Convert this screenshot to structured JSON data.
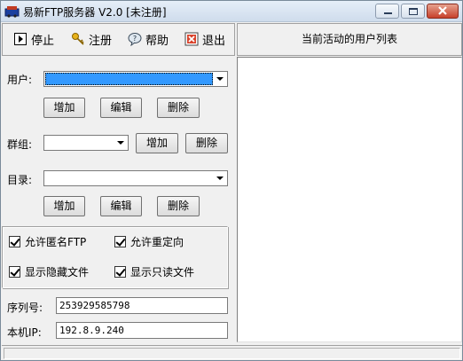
{
  "window": {
    "title": "易新FTP服务器 V2.0 [未注册]"
  },
  "toolbar": {
    "stop_label": "停止",
    "register_label": "注册",
    "help_label": "帮助",
    "exit_label": "退出"
  },
  "right_panel": {
    "header": "当前活动的用户列表"
  },
  "user": {
    "label": "用户:",
    "value": ""
  },
  "user_buttons": {
    "add": "增加",
    "edit": "编辑",
    "delete": "删除"
  },
  "group": {
    "label": "群组:",
    "value": "",
    "add": "增加",
    "delete": "删除"
  },
  "directory": {
    "label": "目录:",
    "value": ""
  },
  "dir_buttons": {
    "add": "增加",
    "edit": "编辑",
    "delete": "删除"
  },
  "options": {
    "allow_anonymous": {
      "label": "允许匿名FTP",
      "checked": true
    },
    "allow_redirect": {
      "label": "允许重定向",
      "checked": true
    },
    "show_hidden": {
      "label": "显示隐藏文件",
      "checked": true
    },
    "show_readonly": {
      "label": "显示只读文件",
      "checked": true
    }
  },
  "serial": {
    "label": "序列号:",
    "value": "253929585798"
  },
  "local_ip": {
    "label": "本机IP:",
    "value": "192.8.9.240"
  },
  "icons": {
    "app": "ftp-app-icon",
    "stop": "stop-icon",
    "register": "key-icon",
    "help": "help-bubble-icon",
    "exit": "exit-icon"
  }
}
